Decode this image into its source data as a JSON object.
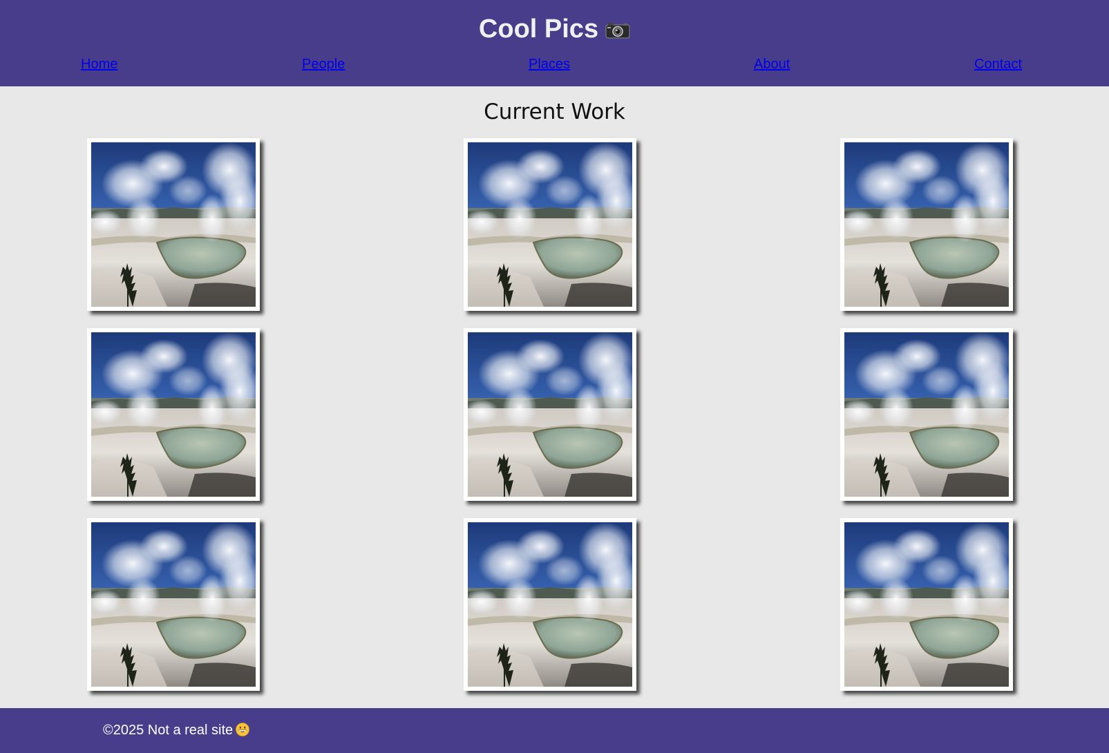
{
  "header": {
    "title": "Cool Pics",
    "title_icon": "camera-icon",
    "background_color": "#483d8b"
  },
  "nav": {
    "items": [
      {
        "label": "Home"
      },
      {
        "label": "People"
      },
      {
        "label": "Places"
      },
      {
        "label": "About"
      },
      {
        "label": "Contact"
      }
    ],
    "link_color": "#0000ee"
  },
  "main": {
    "heading": "Current Work",
    "gallery": {
      "rows": 3,
      "columns": 3,
      "image_subject": "geyser-landscape-photo"
    }
  },
  "footer": {
    "text": "©2025 Not a real site",
    "emoji_icon": "grinning-face-icon",
    "background_color": "#483d8b"
  }
}
